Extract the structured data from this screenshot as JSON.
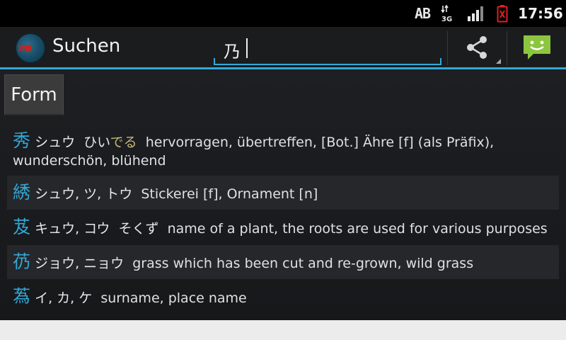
{
  "status_bar": {
    "input_indicator": "AB",
    "network_label": "3G",
    "time": "17:56"
  },
  "action_bar": {
    "title": "Suchen",
    "search_value": "乃",
    "share_icon": "share-icon",
    "message_icon": "message-icon"
  },
  "form_button": {
    "label": "Form"
  },
  "results": [
    {
      "kanji": "秀",
      "on": "シュウ",
      "kun": "ひい",
      "okurigana": "でる",
      "meaning": "hervorragen, übertreffen, [Bot.] Ähre [f] (als Präfix),",
      "meaning2": "wunderschön, blühend"
    },
    {
      "kanji": "綉",
      "on": "シュウ, ツ, トウ",
      "kun": "",
      "okurigana": "",
      "meaning": "Stickerei [f], Ornament [n]"
    },
    {
      "kanji": "芨",
      "on": "キュウ, コウ",
      "kun": "そくず",
      "okurigana": "",
      "meaning": "name of a plant, the roots are used for various purposes"
    },
    {
      "kanji": "芿",
      "on": "ジョウ, ニョウ",
      "kun": "",
      "okurigana": "",
      "meaning": "grass which has been cut and re-grown, wild grass"
    },
    {
      "kanji": "蒍",
      "on": "イ, カ, ケ",
      "kun": "",
      "okurigana": "",
      "meaning": "surname, place name"
    }
  ],
  "colors": {
    "accent": "#33a8d8",
    "okurigana": "#c8b874",
    "background": "#1b1c1e"
  }
}
